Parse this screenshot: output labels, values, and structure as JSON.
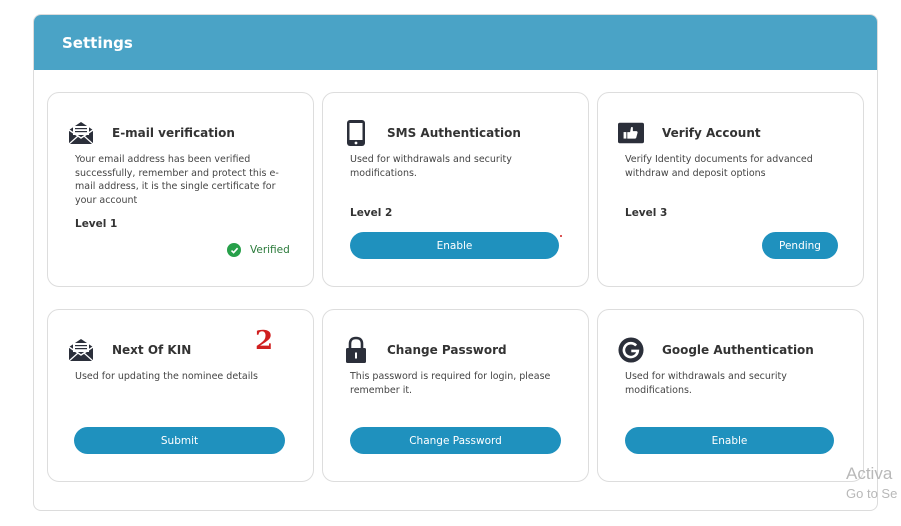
{
  "header": {
    "title": "Settings"
  },
  "cards": {
    "email": {
      "title": "E-mail verification",
      "desc": "Your email address has been verified successfully, remember and protect this e-mail address, it is the single certificate for your account",
      "level": "Level 1",
      "status": "Verified",
      "icon": "envelope-icon"
    },
    "sms": {
      "title": "SMS Authentication",
      "desc": "Used for withdrawals and security modifications.",
      "level": "Level 2",
      "button": "Enable",
      "icon": "phone-icon"
    },
    "verify": {
      "title": "Verify Account",
      "desc": "Verify Identity documents for advanced withdraw and deposit options",
      "level": "Level 3",
      "button": "Pending",
      "icon": "thumbs-up-icon"
    },
    "kin": {
      "title": "Next Of KIN",
      "desc": "Used for updating the nominee details",
      "button": "Submit",
      "icon": "envelope-icon"
    },
    "password": {
      "title": "Change Password",
      "desc": "This password is required for login, please remember it.",
      "button": "Change Password",
      "icon": "lock-icon"
    },
    "google": {
      "title": "Google Authentication",
      "desc": "Used for withdrawals and security modifications.",
      "button": "Enable",
      "icon": "google-icon"
    }
  },
  "annotation": "2",
  "watermark": {
    "line1": "Activa",
    "line2": "Go to Se"
  },
  "colors": {
    "header": "#4aa3c6",
    "button": "#1f91be",
    "verified": "#27a04a",
    "annotation": "#d01f1f"
  }
}
